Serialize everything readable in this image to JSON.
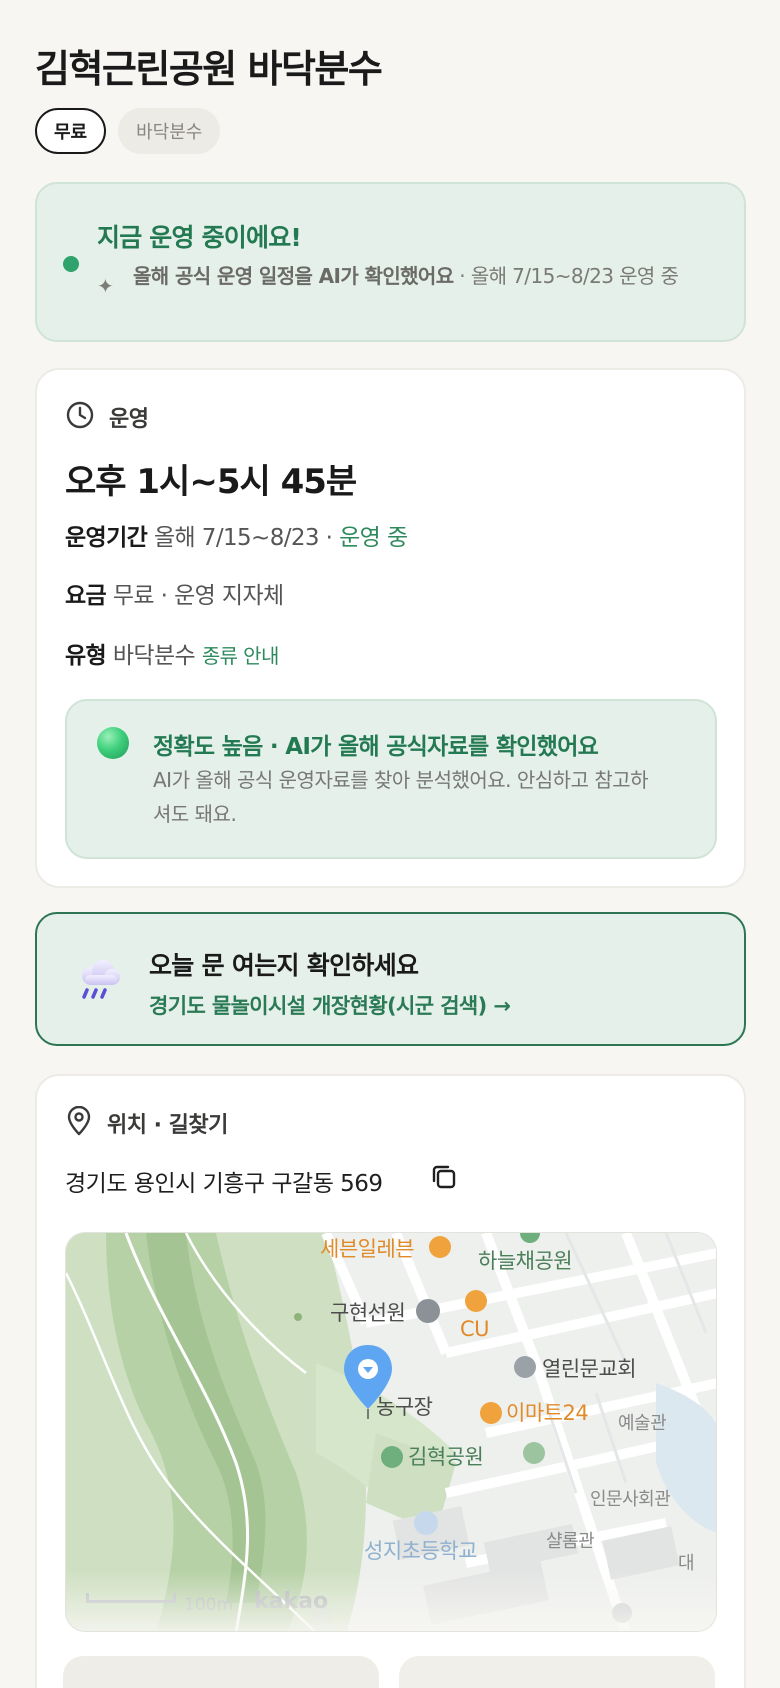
{
  "title": "김혁근린공원 바닥분수",
  "chips": [
    "무료",
    "바닥분수"
  ],
  "status": {
    "title": "지금 운영 중이에요!",
    "sub_bold": "올해 공식 운영 일정을 AI가 확인했어요",
    "sub_rest": " · 올해 7/15~8/23 운영 중"
  },
  "operation": {
    "section_label": "운영",
    "hours": "오후 1시~5시 45분",
    "period_key": "운영기간",
    "period_value": "올해 7/15~8/23 · ",
    "period_status": "운영 중",
    "fee_key": "요금",
    "fee_value": "무료 · 운영 지자체",
    "type_key": "유형",
    "type_value": "바닥분수",
    "type_link": "종류 안내",
    "accuracy_title": "정확도 높음 · AI가 올해 공식자료를 확인했어요",
    "accuracy_desc": "AI가 올해 공식 운영자료를 찾아 분석했어요. 안심하고 참고하셔도 돼요."
  },
  "notice": {
    "title": "오늘 문 여는지 확인하세요",
    "link": "경기도 물놀이시설 개장현황(시군 검색) →"
  },
  "location": {
    "section_label": "위치 · 길찾기",
    "address": "경기도 용인시 기흥구 구갈동 569"
  },
  "map": {
    "labels": {
      "seven_eleven": "세븐일레븐",
      "haneulchae": "하늘채공원",
      "guhyeon": "구현선원",
      "cu": "CU",
      "yeollimmun": "열린문교회",
      "nonggujang": "농구장",
      "emart24": "이마트24",
      "yesulgwan": "예술관",
      "gimhyeok": "김혁공원",
      "inmun": "인문사회관",
      "shalom": "샬롬관",
      "seongji": "성지초등학교",
      "dae": "대"
    },
    "scale": "100m",
    "provider": "kakao"
  },
  "colors": {
    "accent_green": "#2e8a5c",
    "status_bg": "#e6f0ea",
    "page_bg": "#f7f6f2"
  }
}
